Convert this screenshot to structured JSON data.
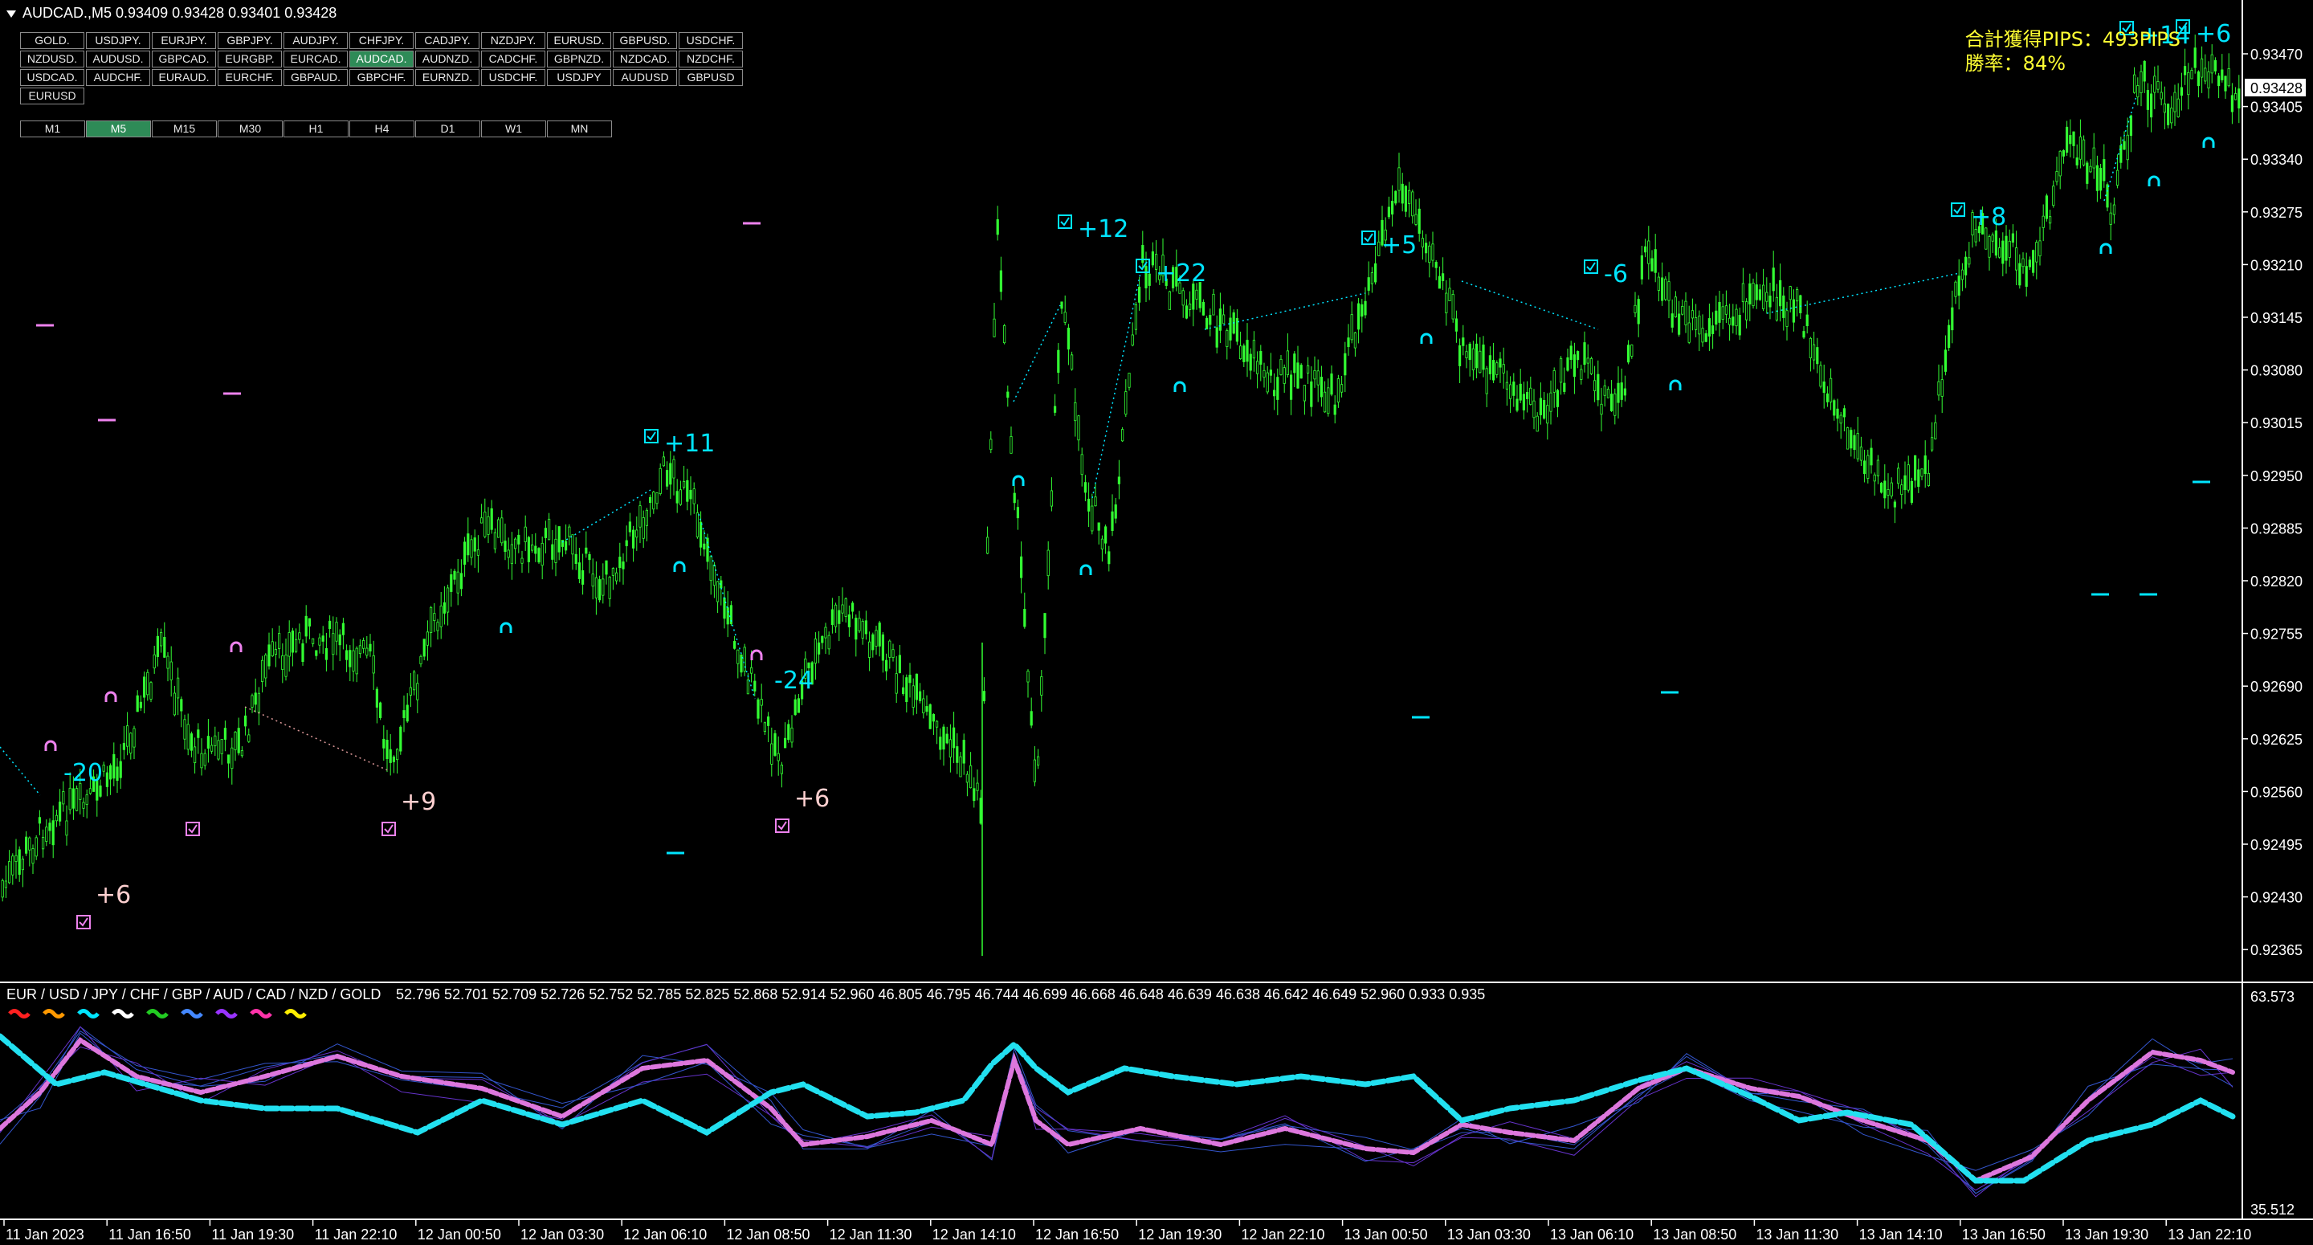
{
  "header": {
    "symbol_text": "AUDCAD.,M5  0.93409 0.93428 0.93401 0.93428"
  },
  "symbol_grid": [
    "GOLD.",
    "USDJPY.",
    "EURJPY.",
    "GBPJPY.",
    "AUDJPY.",
    "CHFJPY.",
    "CADJPY.",
    "NZDJPY.",
    "EURUSD.",
    "GBPUSD.",
    "USDCHF.",
    "NZDUSD.",
    "AUDUSD.",
    "GBPCAD.",
    "EURGBP.",
    "EURCAD.",
    "AUDCAD.",
    "AUDNZD.",
    "CADCHF.",
    "GBPNZD.",
    "NZDCAD.",
    "NZDCHF.",
    "USDCAD.",
    "AUDCHF.",
    "EURAUD.",
    "EURCHF.",
    "GBPAUD.",
    "GBPCHF.",
    "EURNZD.",
    "USDCHF.",
    "USDJPY",
    "AUDUSD",
    "GBPUSD",
    "EURUSD"
  ],
  "symbol_selected": "AUDCAD.",
  "timeframes": [
    "M1",
    "M5",
    "M15",
    "M30",
    "H1",
    "H4",
    "D1",
    "W1",
    "MN"
  ],
  "timeframe_selected": "M5",
  "summary": {
    "total_pips": "合計獲得PIPS：493PIPS",
    "win_rate": "勝率：84%"
  },
  "price_axis": {
    "labels": [
      "0.93470",
      "0.93405",
      "0.93340",
      "0.93275",
      "0.93210",
      "0.93145",
      "0.93080",
      "0.93015",
      "0.92950",
      "0.92885",
      "0.92820",
      "0.92755",
      "0.92690",
      "0.92625",
      "0.92560",
      "0.92495",
      "0.92430",
      "0.92365"
    ],
    "current_price": "0.93428"
  },
  "time_axis": [
    "11 Jan 2023",
    "11 Jan 16:50",
    "11 Jan 19:30",
    "11 Jan 22:10",
    "12 Jan 00:50",
    "12 Jan 03:30",
    "12 Jan 06:10",
    "12 Jan 08:50",
    "12 Jan 11:30",
    "12 Jan 14:10",
    "12 Jan 16:50",
    "12 Jan 19:30",
    "12 Jan 22:10",
    "13 Jan 00:50",
    "13 Jan 03:30",
    "13 Jan 06:10",
    "13 Jan 08:50",
    "13 Jan 11:30",
    "13 Jan 14:10",
    "13 Jan 16:50",
    "13 Jan 19:30",
    "13 Jan 22:10"
  ],
  "trade_labels": {
    "sell": [
      "-20",
      "+11",
      "-24",
      "+12",
      "+22",
      "+5",
      "-6",
      "+8",
      "+14",
      "+6"
    ],
    "buy": [
      "+6",
      "+9",
      "+6"
    ]
  },
  "indicator": {
    "title": "EUR / USD / JPY / CHF / GBP / AUD / CAD / NZD / GOLD",
    "values": "52.796 52.701 52.709 52.726 52.752 52.785 52.825 52.868 52.914 52.960 46.805 46.795 46.744 46.699 46.668 46.648 46.639 46.638 46.642 46.649 52.960 0.933 0.935",
    "axis_max": "63.573",
    "axis_min": "35.512",
    "legend_colors": [
      "#ff2020",
      "#ff9900",
      "#00e5ff",
      "#ffffff",
      "#22cc22",
      "#4488ff",
      "#9933ff",
      "#ff33aa",
      "#ffee00"
    ]
  },
  "colors": {
    "bullish": "#33ff33",
    "sell_signal": "#00e5ff",
    "buy_signal": "#ee82ee",
    "accent_selected": "#2e8b57"
  }
}
